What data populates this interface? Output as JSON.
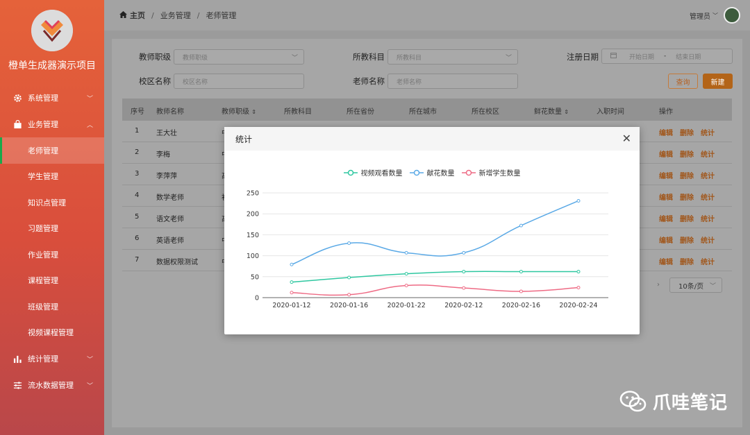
{
  "app": {
    "title": "橙单生成器演示项目",
    "logo_icon": "handshake-logo"
  },
  "sidebar": {
    "menus": [
      {
        "label": "系统管理",
        "icon": "gear-icon",
        "expanded": false
      },
      {
        "label": "业务管理",
        "icon": "bag-icon",
        "expanded": true,
        "children": [
          "老师管理",
          "学生管理",
          "知识点管理",
          "习题管理",
          "作业管理",
          "课程管理",
          "班级管理",
          "视频课程管理"
        ],
        "active_child": "老师管理"
      },
      {
        "label": "统计管理",
        "icon": "bar-chart-icon",
        "expanded": false
      },
      {
        "label": "流水数据管理",
        "icon": "sliders-icon",
        "expanded": false
      }
    ]
  },
  "header": {
    "breadcrumb": [
      "主页",
      "业务管理",
      "老师管理"
    ],
    "user_label": "管理员"
  },
  "filters": {
    "rank": {
      "label": "教师职级",
      "placeholder": "教师职级"
    },
    "subject": {
      "label": "所教科目",
      "placeholder": "所教科目"
    },
    "register_date": {
      "label": "注册日期",
      "start_placeholder": "开始日期",
      "separator": "-",
      "end_placeholder": "结束日期"
    },
    "campus": {
      "label": "校区名称",
      "placeholder": "校区名称"
    },
    "teacher_name": {
      "label": "老师名称",
      "placeholder": "老师名称"
    },
    "query_label": "查询",
    "new_label": "新建"
  },
  "table": {
    "columns": [
      "序号",
      "教师名称",
      "教师职级",
      "所教科目",
      "所在省份",
      "所在城市",
      "所在校区",
      "鲜花数量",
      "入职时间",
      "操作"
    ],
    "rows": [
      {
        "no": "1",
        "name": "王大壮",
        "rank_partial": "中"
      },
      {
        "no": "2",
        "name": "李梅",
        "rank_partial": "中"
      },
      {
        "no": "3",
        "name": "李萍萍",
        "rank_partial": "高"
      },
      {
        "no": "4",
        "name": "数学老师",
        "rank_partial": "初"
      },
      {
        "no": "5",
        "name": "语文老师",
        "rank_partial": "高"
      },
      {
        "no": "6",
        "name": "英语老师",
        "rank_partial": "中"
      },
      {
        "no": "7",
        "name": "数据权限测试",
        "rank_partial": "中"
      }
    ],
    "ops": [
      "编辑",
      "删除",
      "统计"
    ]
  },
  "pager": {
    "arrow": "›",
    "page_size": "10条/页"
  },
  "modal": {
    "title": "统计",
    "close": "✕",
    "chart_data": {
      "type": "line",
      "categories": [
        "2020-01-12",
        "2020-01-16",
        "2020-01-22",
        "2020-02-12",
        "2020-02-16",
        "2020-02-24"
      ],
      "ylim": [
        0,
        250
      ],
      "yticks": [
        0,
        50,
        100,
        150,
        200,
        250
      ],
      "grid": true,
      "legend_position": "top-center",
      "series": [
        {
          "name": "视频观看数量",
          "color": "#2ec7a0",
          "values": [
            37,
            48,
            57,
            62,
            62,
            62
          ]
        },
        {
          "name": "献花数量",
          "color": "#5aa9e6",
          "values": [
            79,
            130,
            107,
            107,
            172,
            231
          ]
        },
        {
          "name": "新增学生数量",
          "color": "#ee6a84",
          "values": [
            12,
            7,
            29,
            23,
            15,
            24
          ]
        }
      ]
    }
  },
  "watermark": {
    "text": "爪哇笔记",
    "icon": "wechat-icon"
  }
}
